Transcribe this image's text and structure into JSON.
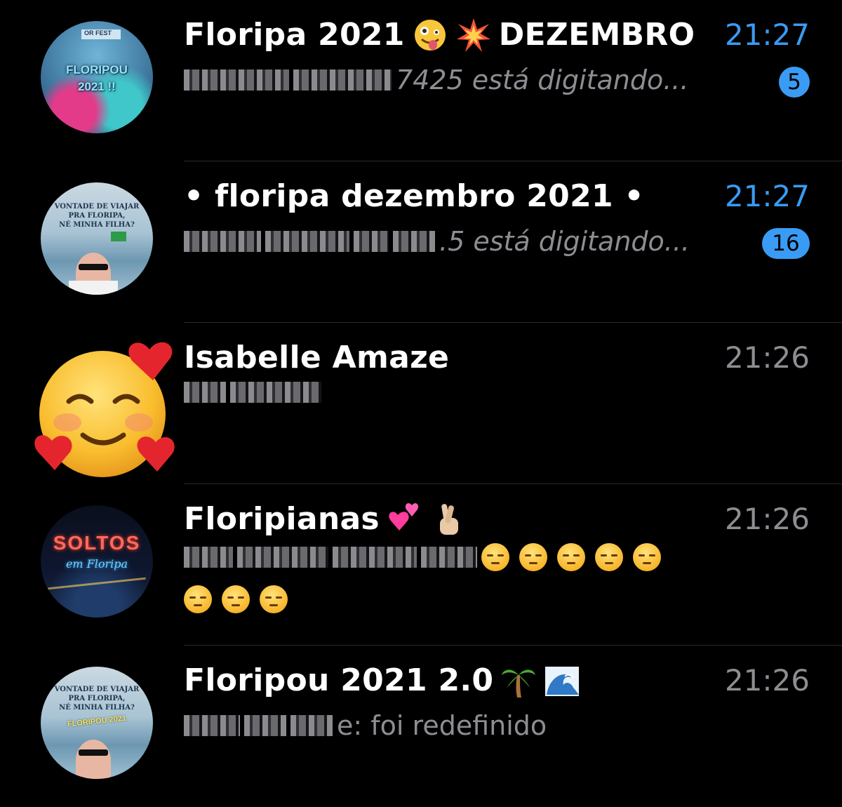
{
  "chats": [
    {
      "title": "Floripa 2021",
      "title_suffix": "DEZEMBRO",
      "title_icons": [
        "zany-face-icon",
        "collision-icon"
      ],
      "time": "21:27",
      "time_unread": true,
      "preview": "7425 está digitando...",
      "unread_count": "5",
      "avatar_text": [
        "FLORIPOU",
        "2021 !!"
      ],
      "avatar_top_text": "OR FEST"
    },
    {
      "title": "• floripa dezembro 2021 •",
      "time": "21:27",
      "time_unread": true,
      "preview": ".5 está digitando...",
      "unread_count": "16",
      "avatar_text": [
        "VONTADE DE VIAJAR",
        "PRA FLORIPA,",
        "NÉ MINHA FILHA?"
      ]
    },
    {
      "title": "Isabelle Amaze",
      "time": "21:26",
      "time_unread": false,
      "avatar_icon": "smiling-face-with-hearts-icon"
    },
    {
      "title": "Floripianas",
      "title_icons": [
        "two-hearts-icon",
        "crossed-fingers-icon"
      ],
      "time": "21:26",
      "time_unread": false,
      "preview_emoji_count_line1": 5,
      "preview_emoji_count_line2": 3,
      "preview_icon": "pensive-face-icon",
      "avatar_text": [
        "SOLTOS",
        "em Floripa"
      ]
    },
    {
      "title": "Floripou 2021 2.0",
      "title_icons": [
        "palm-tree-icon",
        "water-wave-icon"
      ],
      "time": "21:26",
      "time_unread": false,
      "preview": "e: foi redefinido",
      "avatar_text": [
        "VONTADE DE VIAJAR",
        "PRA FLORIPA,",
        "NÉ MINHA FILHA?",
        "FLORIPOU 2021"
      ]
    }
  ],
  "colors": {
    "background": "#000000",
    "unread_accent": "#3a9bf4",
    "secondary_text": "#8d8d93",
    "separator": "#2a2a2c"
  }
}
